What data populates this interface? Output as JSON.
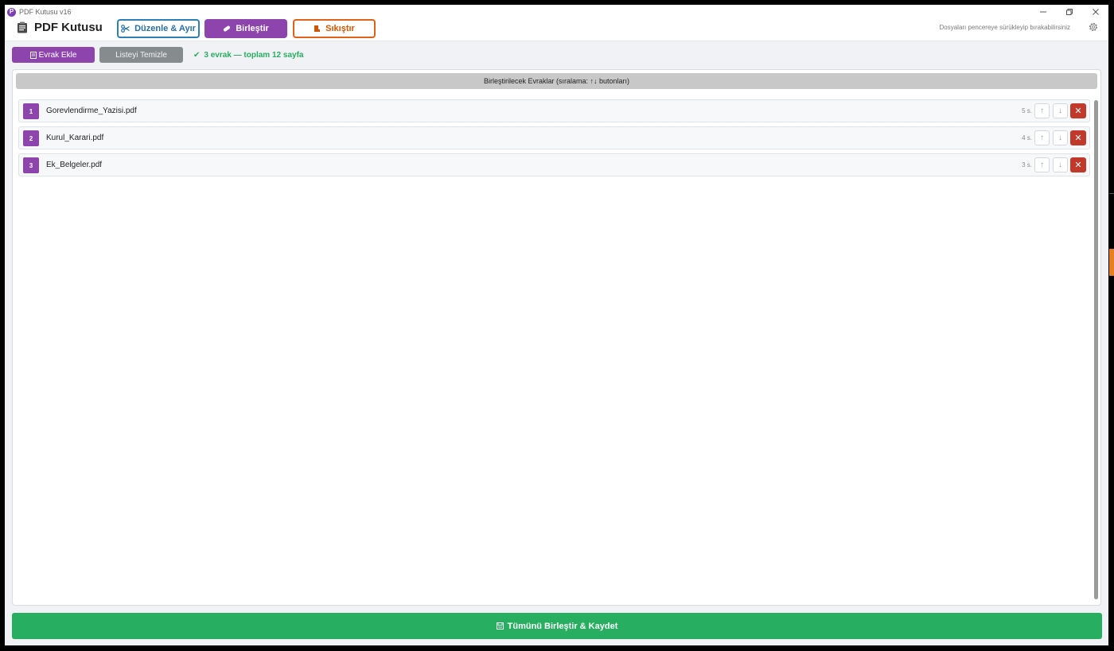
{
  "window": {
    "title": "PDF Kutusu v16",
    "app_icon_letter": "P"
  },
  "header": {
    "brand": "PDF Kutusu",
    "tabs": [
      {
        "label": "Düzenle & Ayır",
        "icon": "scissors-icon",
        "color": "#2a6ea0"
      },
      {
        "label": "Birleştir",
        "icon": "link-icon",
        "color": "#8e44ad"
      },
      {
        "label": "Sıkıştır",
        "icon": "compress-icon",
        "color": "#d35400"
      }
    ],
    "hint": "Dosyaları pencereye sürükleyip bırakabilirsiniz"
  },
  "toolbar": {
    "add_label": "Evrak Ekle",
    "clear_label": "Listeyi Temizle",
    "status_text": "3 evrak — toplam 12 sayfa",
    "status_color": "#27ae60"
  },
  "panel": {
    "header": "Birleştirilecek Evraklar (sıralama: ↑↓ butonları)"
  },
  "files": [
    {
      "index": "1",
      "name": "Gorevlendirme_Yazisi.pdf",
      "pages": "5 s."
    },
    {
      "index": "2",
      "name": "Kurul_Karari.pdf",
      "pages": "4 s."
    },
    {
      "index": "3",
      "name": "Ek_Belgeler.pdf",
      "pages": "3 s."
    }
  ],
  "footer": {
    "merge_all_label": "Tümünü Birleştir & Kaydet"
  },
  "colors": {
    "accent": "#8e44ad",
    "success": "#27ae60",
    "danger": "#c0392b",
    "neutral": "#868b8e"
  }
}
